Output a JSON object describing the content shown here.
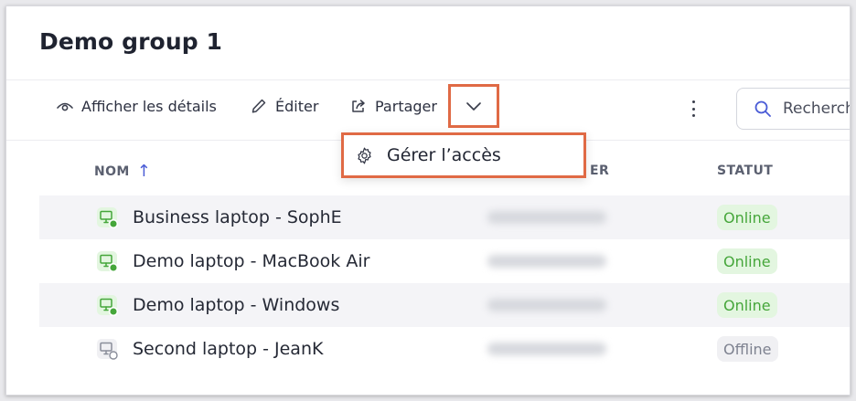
{
  "page": {
    "title": "Demo group 1"
  },
  "toolbar": {
    "details_label": "Afficher les détails",
    "edit_label": "Éditer",
    "share_label": "Partager",
    "search_placeholder": "Rechercher"
  },
  "dropdown": {
    "manage_access_label": "Gérer l’accès"
  },
  "table": {
    "columns": {
      "name": "NOM",
      "serial": "ER",
      "status": "STATUT"
    },
    "rows": [
      {
        "name": "Business laptop - SophE",
        "status": "Online",
        "online": true
      },
      {
        "name": "Demo laptop - MacBook Air",
        "status": "Online",
        "online": true
      },
      {
        "name": "Demo laptop - Windows",
        "status": "Online",
        "online": true
      },
      {
        "name": "Second laptop - JeanK",
        "status": "Offline",
        "online": false
      }
    ]
  },
  "colors": {
    "accent": "#e06a45",
    "online_green": "#45a63a",
    "sort_arrow": "#4a5cd6"
  }
}
